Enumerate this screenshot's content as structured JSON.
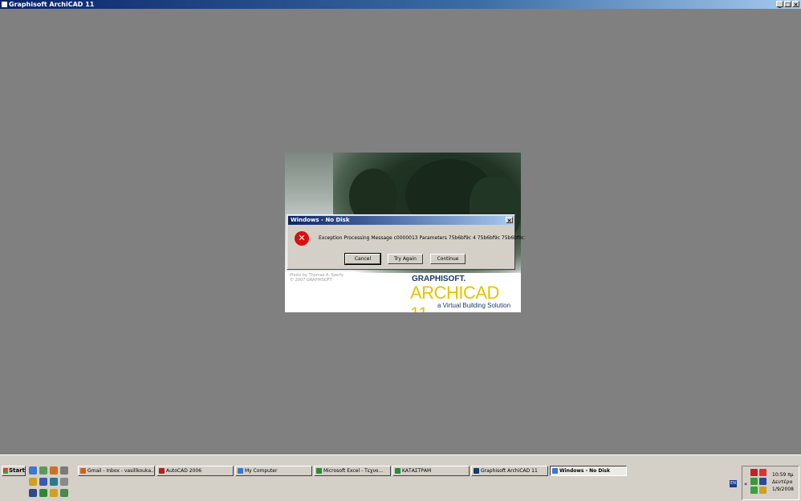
{
  "window": {
    "title": "Graphisoft ArchiCAD 11",
    "min": "_",
    "max": "□",
    "close": "×"
  },
  "splash": {
    "credit_line1": "Photo by Thomas A. Szerly",
    "credit_line2": "© 2007 GRAPHISOFT",
    "brand": "GRAPHISOFT.",
    "product": "ARCHICAD 11",
    "tagline": "a Virtual Building Solution"
  },
  "dialog": {
    "title": "Windows - No Disk",
    "close": "×",
    "icon_glyph": "✕",
    "message": "Exception Processing Message c0000013 Parameters 75b6bf9c 4 75b6bf9c 75b6bf9c",
    "buttons": {
      "cancel": "Cancel",
      "try_again": "Try Again",
      "continue": "Continue"
    }
  },
  "taskbar": {
    "start": "Start",
    "tasks": [
      {
        "label": "Gmail - Inbox - vasillkouka...",
        "icon_color": "#c8641e"
      },
      {
        "label": "AutoCAD 2006",
        "icon_color": "#b02020"
      },
      {
        "label": "My Computer",
        "icon_color": "#3c78c8"
      },
      {
        "label": "Microsoft Excel - Τεχνο...",
        "icon_color": "#2a8a3a"
      },
      {
        "label": "ΚΑΤΑΣΤΡΑΜ",
        "icon_color": "#2a8a3a"
      },
      {
        "label": "Graphisoft ArchiCAD 11",
        "icon_color": "#1a3a6a"
      },
      {
        "label": "Windows - No Disk",
        "icon_color": "#3c78c8"
      }
    ],
    "lang": "EN",
    "tray_chevron": "«",
    "clock": {
      "time": "10:59 πμ",
      "day": "Δευτέρα",
      "date": "1/9/2008"
    }
  },
  "colors": {
    "desktop": "#808080",
    "titlebar": "#0a246a",
    "error_red": "#d81010"
  }
}
